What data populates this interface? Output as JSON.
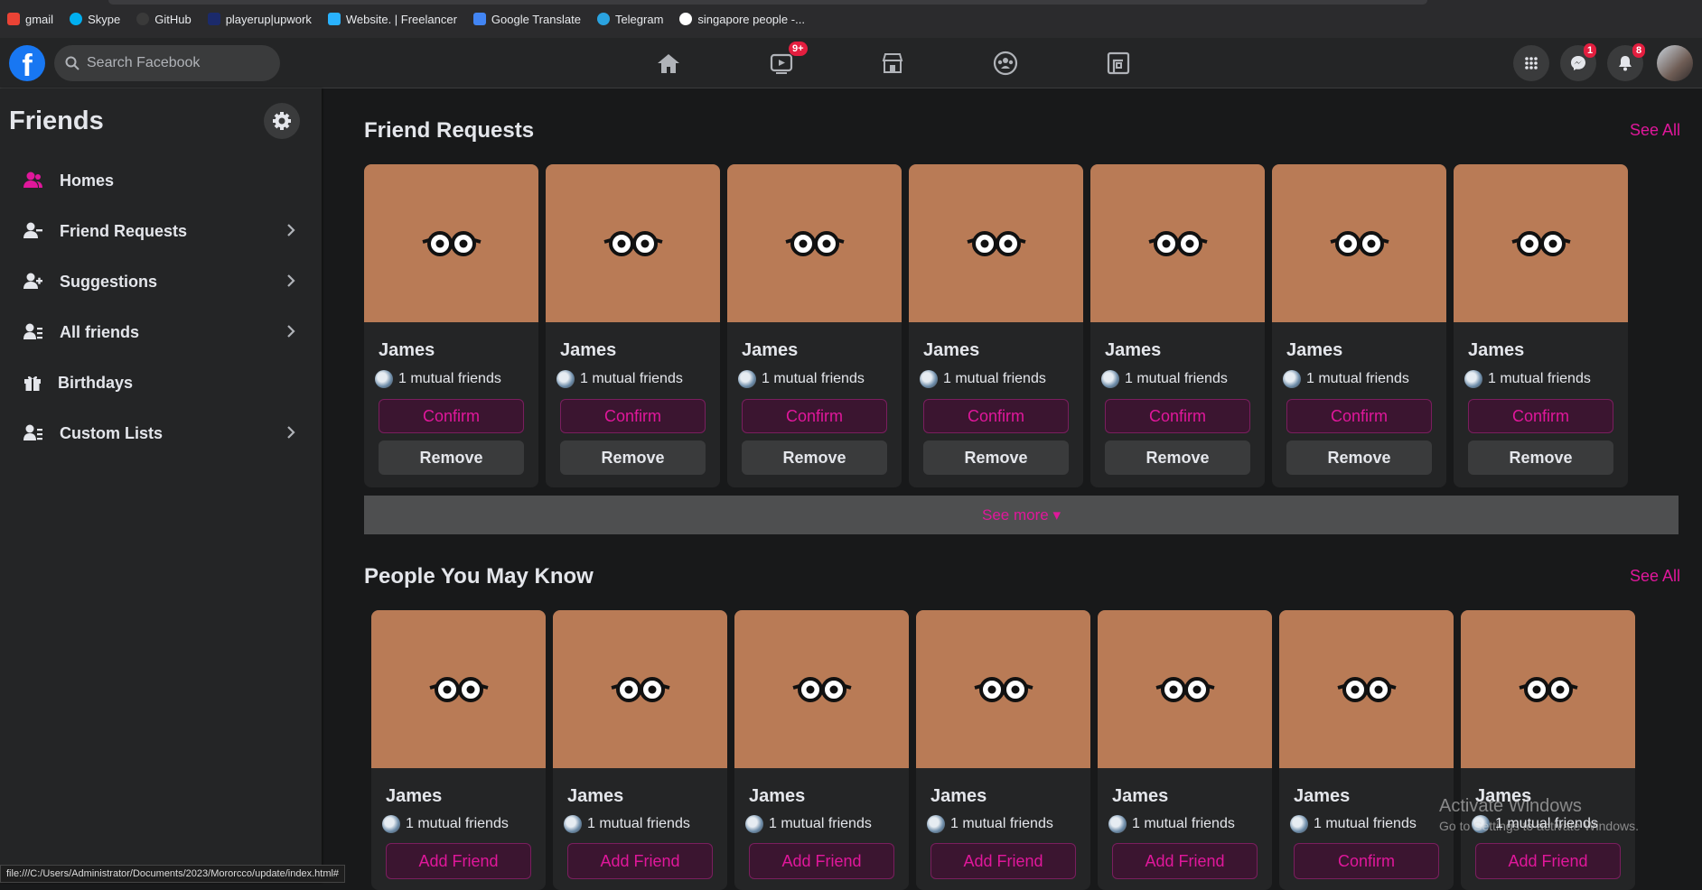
{
  "bookmarks": [
    {
      "label": "gmail",
      "icon": "gmail-icon",
      "color": "#ea4335"
    },
    {
      "label": "Skype",
      "icon": "skype-icon",
      "color": "#00aff0"
    },
    {
      "label": "GitHub",
      "icon": "github-icon",
      "color": "#333333"
    },
    {
      "label": "playerup|upwork",
      "icon": "playerup-icon",
      "color": "#1b2a6b"
    },
    {
      "label": "Website. | Freelancer",
      "icon": "freelancer-icon",
      "color": "#29b2fe"
    },
    {
      "label": "Google Translate",
      "icon": "translate-icon",
      "color": "#4285f4"
    },
    {
      "label": "Telegram",
      "icon": "telegram-icon",
      "color": "#2aa3e0"
    },
    {
      "label": "singapore people -...",
      "icon": "google-icon",
      "color": "#ffffff"
    }
  ],
  "header": {
    "logo": "f",
    "search_placeholder": "Search Facebook",
    "watch_badge": "9+",
    "messenger_badge": "1",
    "notifications_badge": "8"
  },
  "sidebar": {
    "title": "Friends",
    "items": [
      {
        "label": "Homes",
        "icon": "friends-home-icon",
        "chevron": false,
        "active": true
      },
      {
        "label": "Friend Requests",
        "icon": "friend-requests-icon",
        "chevron": true
      },
      {
        "label": "Suggestions",
        "icon": "suggestions-icon",
        "chevron": true
      },
      {
        "label": "All friends",
        "icon": "all-friends-icon",
        "chevron": true
      },
      {
        "label": "Birthdays",
        "icon": "gift-icon",
        "chevron": false
      },
      {
        "label": "Custom Lists",
        "icon": "custom-lists-icon",
        "chevron": true
      }
    ]
  },
  "friend_requests": {
    "title": "Friend Requests",
    "see_all": "See All",
    "cards": [
      {
        "name": "James",
        "mutual": "1 mutual friends",
        "confirm": "Confirm",
        "remove": "Remove"
      },
      {
        "name": "James",
        "mutual": "1 mutual friends",
        "confirm": "Confirm",
        "remove": "Remove"
      },
      {
        "name": "James",
        "mutual": "1 mutual friends",
        "confirm": "Confirm",
        "remove": "Remove"
      },
      {
        "name": "James",
        "mutual": "1 mutual friends",
        "confirm": "Confirm",
        "remove": "Remove"
      },
      {
        "name": "James",
        "mutual": "1 mutual friends",
        "confirm": "Confirm",
        "remove": "Remove"
      },
      {
        "name": "James",
        "mutual": "1 mutual friends",
        "confirm": "Confirm",
        "remove": "Remove"
      },
      {
        "name": "James",
        "mutual": "1 mutual friends",
        "confirm": "Confirm",
        "remove": "Remove"
      }
    ],
    "see_more": "See more ▾"
  },
  "people_you_may_know": {
    "title": "People You May Know",
    "see_all": "See All",
    "cards": [
      {
        "name": "James",
        "mutual": "1 mutual friends",
        "action": "Add Friend"
      },
      {
        "name": "James",
        "mutual": "1 mutual friends",
        "action": "Add Friend"
      },
      {
        "name": "James",
        "mutual": "1 mutual friends",
        "action": "Add Friend"
      },
      {
        "name": "James",
        "mutual": "1 mutual friends",
        "action": "Add Friend"
      },
      {
        "name": "James",
        "mutual": "1 mutual friends",
        "action": "Add Friend"
      },
      {
        "name": "James",
        "mutual": "1 mutual friends",
        "action": "Confirm"
      },
      {
        "name": "James",
        "mutual": "1 mutual friends",
        "action": "Add Friend"
      }
    ]
  },
  "status_bar": "file:///C:/Users/Administrator/Documents/2023/Mororcco/update/index.html#",
  "watermark": {
    "line1": "Activate Windows",
    "line2": "Go to Settings to activate Windows."
  },
  "colors": {
    "accent": "#e0179b",
    "card_photo": "#b97b56",
    "background": "#18191a",
    "surface": "#242526"
  }
}
